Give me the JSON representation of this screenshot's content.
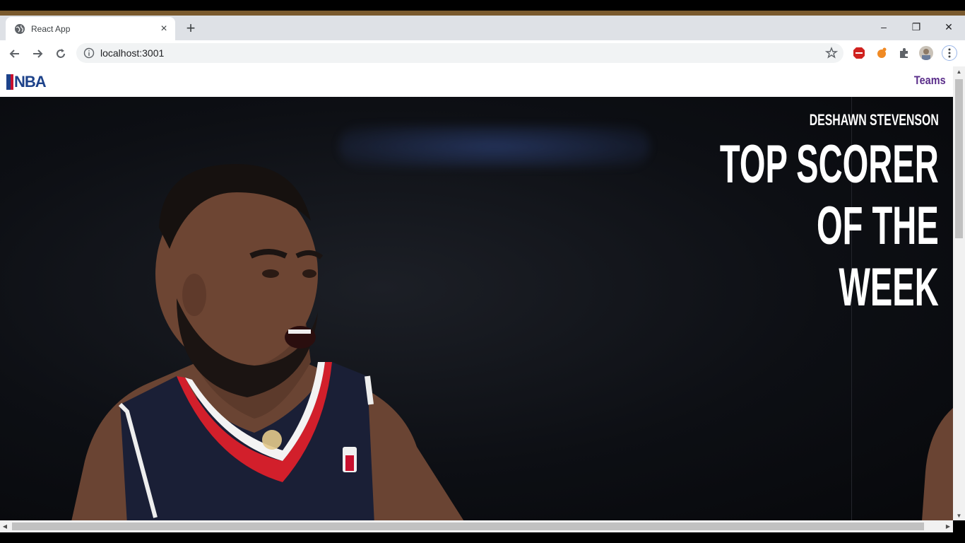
{
  "browser": {
    "tab_title": "React App",
    "tab_close": "×",
    "new_tab": "+",
    "url": "localhost:3001",
    "window_controls": {
      "minimize": "–",
      "restore": "❐",
      "close": "✕"
    }
  },
  "site": {
    "logo_text": "NBA",
    "nav": {
      "teams": "Teams"
    },
    "hero": {
      "player_name": "DESHAWN STEVENSON",
      "headline": "TOP SCORER\nOF THE\nWEEK"
    }
  },
  "icons": [
    "globe-icon",
    "back-icon",
    "forward-icon",
    "reload-icon",
    "info-icon",
    "star-icon",
    "adblock-icon",
    "extension-icon",
    "puzzle-icon",
    "profile-avatar",
    "menu-dots-icon"
  ],
  "colors": {
    "nba_blue": "#1d428a",
    "nba_red": "#c8102e",
    "teams_link": "#5a2d8a"
  }
}
